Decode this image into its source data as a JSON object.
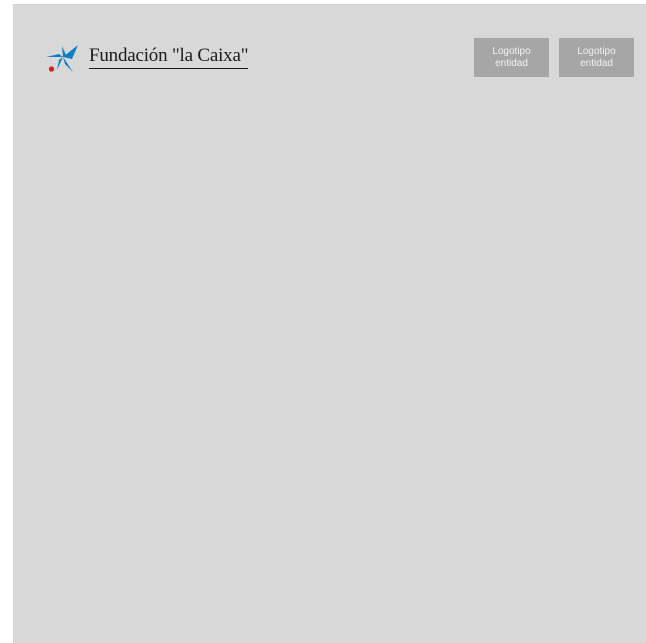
{
  "brand": {
    "name": "Fundación \"la Caixa\"",
    "mark_icon": "caixa-star-icon",
    "colors": {
      "star": "#0a7fc4",
      "dot": "#d61b1b"
    }
  },
  "entity_logos": [
    {
      "line1": "Logotipo",
      "line2": "entidad"
    },
    {
      "line1": "Logotipo",
      "line2": "entidad"
    }
  ],
  "colors": {
    "background": "#d8d8d8",
    "logo_placeholder": "#a6a6a6",
    "logo_placeholder_text": "#f2f2f2"
  }
}
